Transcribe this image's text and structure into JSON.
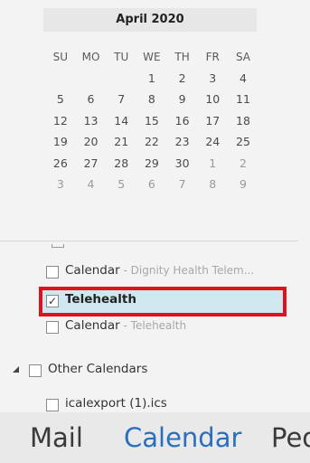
{
  "navigator": {
    "month_title": "April 2020",
    "weekdays": [
      "SU",
      "MO",
      "TU",
      "WE",
      "TH",
      "FR",
      "SA"
    ],
    "weeks": [
      [
        "",
        "",
        "",
        "1",
        "2",
        "3",
        "4"
      ],
      [
        "5",
        "6",
        "7",
        "8",
        "9",
        "10",
        "11"
      ],
      [
        "12",
        "13",
        "14",
        "15",
        "16",
        "17",
        "18"
      ],
      [
        "19",
        "20",
        "21",
        "22",
        "23",
        "24",
        "25"
      ],
      [
        "26",
        "27",
        "28",
        "29",
        "30",
        "1",
        "2"
      ],
      [
        "3",
        "4",
        "5",
        "6",
        "7",
        "8",
        "9"
      ]
    ]
  },
  "folders": {
    "calendar1": {
      "label": "Calendar",
      "sub": " - Dignity Health Telem..."
    },
    "telehealth": {
      "label": "Telehealth",
      "checked": true
    },
    "calendar2": {
      "label": "Calendar",
      "sub": " - Telehealth"
    },
    "other_group": {
      "label": "Other Calendars"
    },
    "ics": {
      "label": "icalexport (1).ics"
    }
  },
  "nav": {
    "mail": "Mail",
    "calendar": "Calendar",
    "people": "Peo"
  },
  "colors": {
    "selection_bg": "#cfe8ef",
    "highlight_border": "#e0101e",
    "active_nav": "#2a6fbd"
  }
}
